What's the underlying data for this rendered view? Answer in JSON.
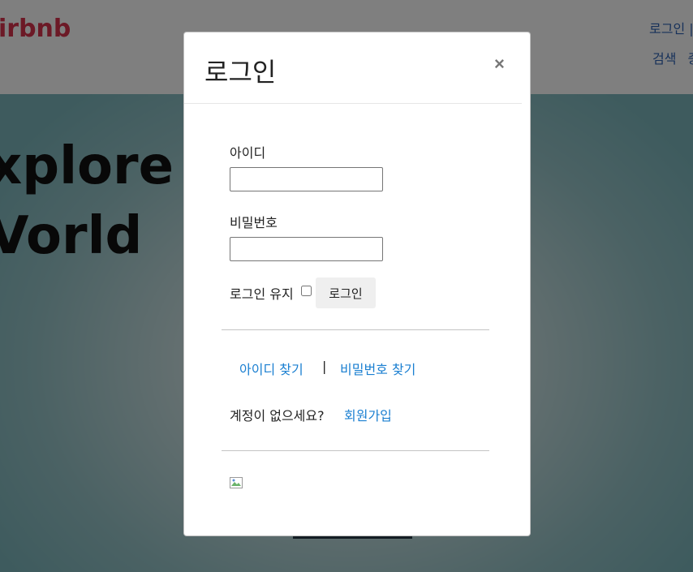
{
  "background": {
    "brand": "irbnb",
    "nav_top": "로그인 |",
    "nav_links": [
      "검색",
      "중"
    ],
    "hero_title_line1": "xplore T",
    "hero_title_line2": "Vorld"
  },
  "modal": {
    "title": "로그인",
    "close_symbol": "×",
    "id_label": "아이디",
    "id_value": "",
    "password_label": "비밀번호",
    "password_value": "",
    "remember_label": "로그인 유지",
    "remember_checked": false,
    "login_button": "로그인",
    "find_id_link": "아이디 찾기",
    "separator": "|",
    "find_password_link": "비밀번호 찾기",
    "no_account_text": "계정이 없으세요?",
    "signup_link": "회원가입",
    "image_icon": "broken-image-icon"
  },
  "colors": {
    "brand": "#d9324c",
    "link": "#1a7fd1",
    "nav_link": "#2e63b5"
  }
}
